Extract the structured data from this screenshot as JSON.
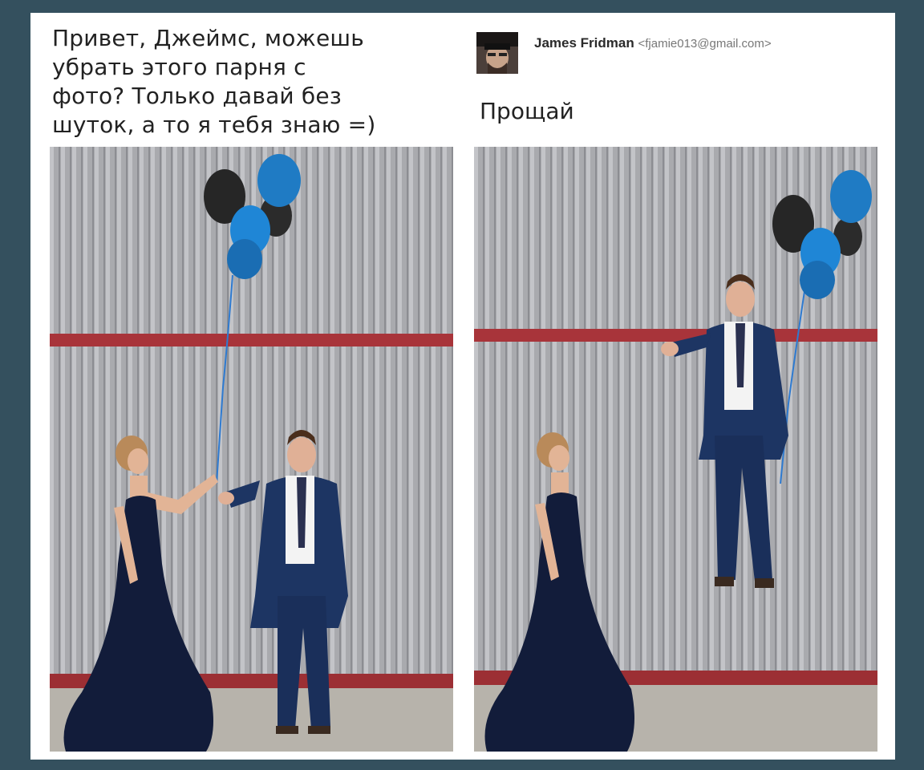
{
  "request": {
    "lines": [
      "Привет, Джеймс, можешь",
      "убрать этого парня с",
      "фото? Только давай без",
      "шуток, а то я тебя знаю =)"
    ]
  },
  "reply": {
    "sender_name": "James Fridman",
    "sender_email": "<fjamie013@gmail.com>",
    "message": "Прощай"
  },
  "photos": {
    "left": {
      "subject": "prom couple with balloons, original",
      "icon": "photo"
    },
    "right": {
      "subject": "edited photo, man floating with balloons",
      "icon": "photo"
    }
  },
  "colors": {
    "background": "#34505e",
    "card": "#ffffff",
    "wall": "#a9aaae",
    "red_stripe": "#a8343a",
    "balloon_blue": "#1f7bc4",
    "balloon_black": "#262626",
    "suit": "#1d3563",
    "dress": "#121c3a"
  }
}
